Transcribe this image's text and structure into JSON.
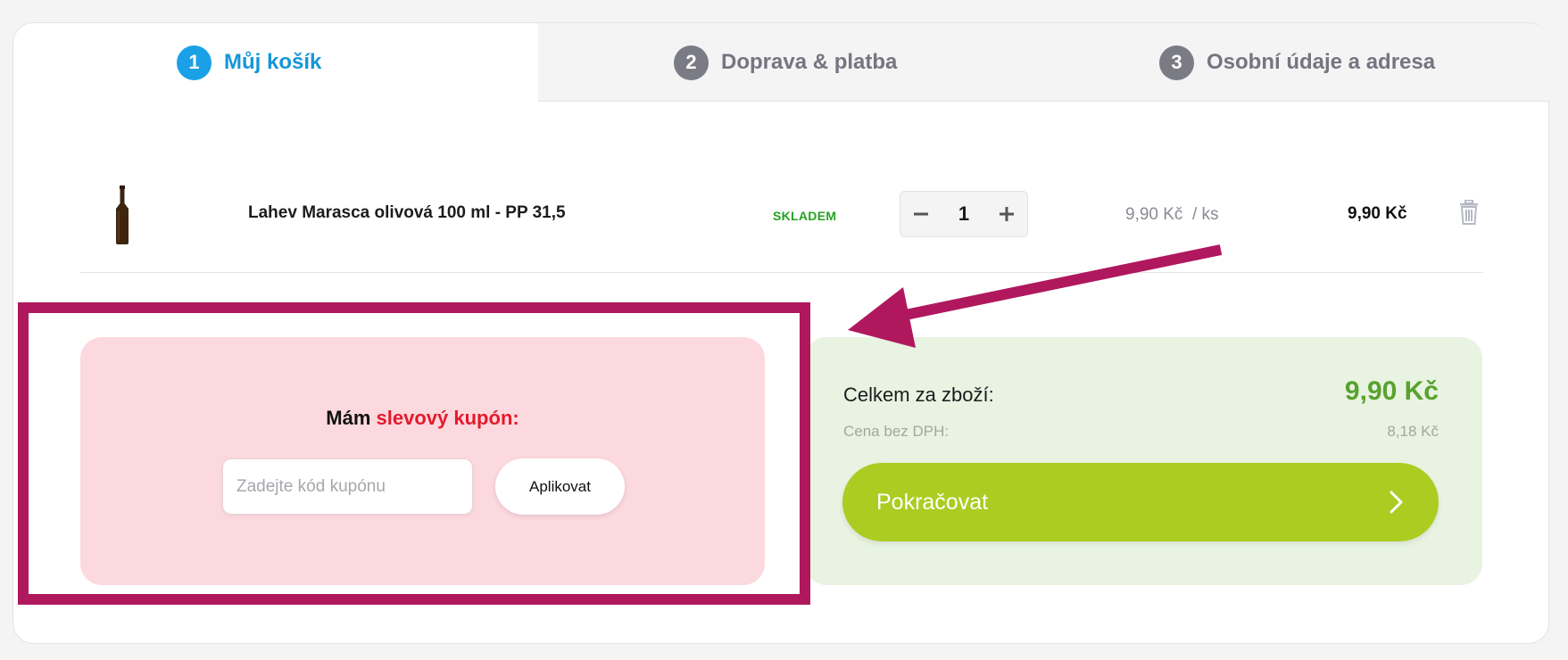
{
  "steps": [
    {
      "number": "1",
      "label": "Můj košík"
    },
    {
      "number": "2",
      "label": "Doprava & platba"
    },
    {
      "number": "3",
      "label": "Osobní údaje a adresa"
    }
  ],
  "cart": {
    "item": {
      "name": "Lahev Marasca olivová 100 ml - PP 31,5",
      "stock": "SKLADEM",
      "quantity": "1",
      "unit_price": "9,90 Kč  / ks",
      "total": "9,90 Kč"
    }
  },
  "coupon": {
    "title_prefix": "Mám",
    "title_highlight": "slevový kupón:",
    "placeholder": "Zadejte kód kupónu",
    "apply_label": "Aplikovat"
  },
  "summary": {
    "total_label": "Celkem za zboží:",
    "total_value": "9,90 Kč",
    "net_label": "Cena bez DPH:",
    "net_value": "8,18 Kč",
    "continue_label": "Pokračovat"
  },
  "colors": {
    "active_step": "#1aa0e6",
    "stock_green": "#25a31f",
    "total_green": "#58a22e",
    "continue_button": "#accc21",
    "coupon_bg": "#fcd9de",
    "summary_bg": "#e8f3e1",
    "annotation": "#b0185e"
  },
  "icons": [
    "minus-icon",
    "plus-icon",
    "trash-icon",
    "chevron-right-icon",
    "bottle-product-image",
    "annotation-arrow"
  ]
}
